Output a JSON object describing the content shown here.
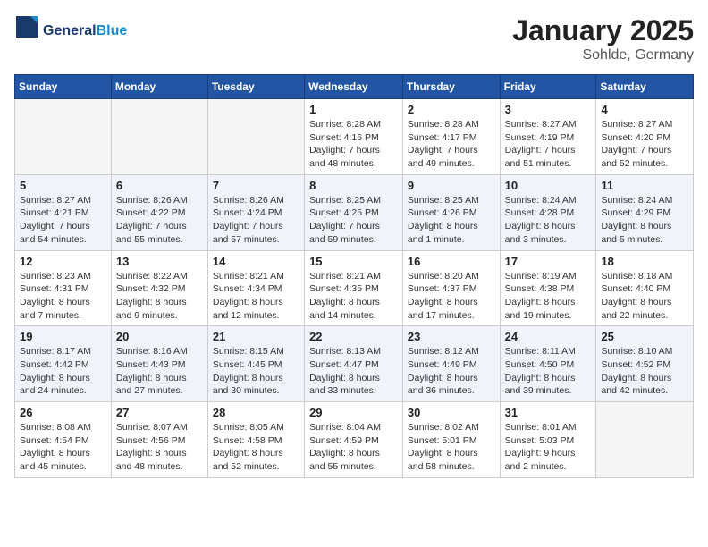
{
  "header": {
    "logo_general": "General",
    "logo_blue": "Blue",
    "title": "January 2025",
    "subtitle": "Sohlde, Germany"
  },
  "weekdays": [
    "Sunday",
    "Monday",
    "Tuesday",
    "Wednesday",
    "Thursday",
    "Friday",
    "Saturday"
  ],
  "weeks": [
    [
      {
        "day": "",
        "info": ""
      },
      {
        "day": "",
        "info": ""
      },
      {
        "day": "",
        "info": ""
      },
      {
        "day": "1",
        "info": "Sunrise: 8:28 AM\nSunset: 4:16 PM\nDaylight: 7 hours and 48 minutes."
      },
      {
        "day": "2",
        "info": "Sunrise: 8:28 AM\nSunset: 4:17 PM\nDaylight: 7 hours and 49 minutes."
      },
      {
        "day": "3",
        "info": "Sunrise: 8:27 AM\nSunset: 4:19 PM\nDaylight: 7 hours and 51 minutes."
      },
      {
        "day": "4",
        "info": "Sunrise: 8:27 AM\nSunset: 4:20 PM\nDaylight: 7 hours and 52 minutes."
      }
    ],
    [
      {
        "day": "5",
        "info": "Sunrise: 8:27 AM\nSunset: 4:21 PM\nDaylight: 7 hours and 54 minutes."
      },
      {
        "day": "6",
        "info": "Sunrise: 8:26 AM\nSunset: 4:22 PM\nDaylight: 7 hours and 55 minutes."
      },
      {
        "day": "7",
        "info": "Sunrise: 8:26 AM\nSunset: 4:24 PM\nDaylight: 7 hours and 57 minutes."
      },
      {
        "day": "8",
        "info": "Sunrise: 8:25 AM\nSunset: 4:25 PM\nDaylight: 7 hours and 59 minutes."
      },
      {
        "day": "9",
        "info": "Sunrise: 8:25 AM\nSunset: 4:26 PM\nDaylight: 8 hours and 1 minute."
      },
      {
        "day": "10",
        "info": "Sunrise: 8:24 AM\nSunset: 4:28 PM\nDaylight: 8 hours and 3 minutes."
      },
      {
        "day": "11",
        "info": "Sunrise: 8:24 AM\nSunset: 4:29 PM\nDaylight: 8 hours and 5 minutes."
      }
    ],
    [
      {
        "day": "12",
        "info": "Sunrise: 8:23 AM\nSunset: 4:31 PM\nDaylight: 8 hours and 7 minutes."
      },
      {
        "day": "13",
        "info": "Sunrise: 8:22 AM\nSunset: 4:32 PM\nDaylight: 8 hours and 9 minutes."
      },
      {
        "day": "14",
        "info": "Sunrise: 8:21 AM\nSunset: 4:34 PM\nDaylight: 8 hours and 12 minutes."
      },
      {
        "day": "15",
        "info": "Sunrise: 8:21 AM\nSunset: 4:35 PM\nDaylight: 8 hours and 14 minutes."
      },
      {
        "day": "16",
        "info": "Sunrise: 8:20 AM\nSunset: 4:37 PM\nDaylight: 8 hours and 17 minutes."
      },
      {
        "day": "17",
        "info": "Sunrise: 8:19 AM\nSunset: 4:38 PM\nDaylight: 8 hours and 19 minutes."
      },
      {
        "day": "18",
        "info": "Sunrise: 8:18 AM\nSunset: 4:40 PM\nDaylight: 8 hours and 22 minutes."
      }
    ],
    [
      {
        "day": "19",
        "info": "Sunrise: 8:17 AM\nSunset: 4:42 PM\nDaylight: 8 hours and 24 minutes."
      },
      {
        "day": "20",
        "info": "Sunrise: 8:16 AM\nSunset: 4:43 PM\nDaylight: 8 hours and 27 minutes."
      },
      {
        "day": "21",
        "info": "Sunrise: 8:15 AM\nSunset: 4:45 PM\nDaylight: 8 hours and 30 minutes."
      },
      {
        "day": "22",
        "info": "Sunrise: 8:13 AM\nSunset: 4:47 PM\nDaylight: 8 hours and 33 minutes."
      },
      {
        "day": "23",
        "info": "Sunrise: 8:12 AM\nSunset: 4:49 PM\nDaylight: 8 hours and 36 minutes."
      },
      {
        "day": "24",
        "info": "Sunrise: 8:11 AM\nSunset: 4:50 PM\nDaylight: 8 hours and 39 minutes."
      },
      {
        "day": "25",
        "info": "Sunrise: 8:10 AM\nSunset: 4:52 PM\nDaylight: 8 hours and 42 minutes."
      }
    ],
    [
      {
        "day": "26",
        "info": "Sunrise: 8:08 AM\nSunset: 4:54 PM\nDaylight: 8 hours and 45 minutes."
      },
      {
        "day": "27",
        "info": "Sunrise: 8:07 AM\nSunset: 4:56 PM\nDaylight: 8 hours and 48 minutes."
      },
      {
        "day": "28",
        "info": "Sunrise: 8:05 AM\nSunset: 4:58 PM\nDaylight: 8 hours and 52 minutes."
      },
      {
        "day": "29",
        "info": "Sunrise: 8:04 AM\nSunset: 4:59 PM\nDaylight: 8 hours and 55 minutes."
      },
      {
        "day": "30",
        "info": "Sunrise: 8:02 AM\nSunset: 5:01 PM\nDaylight: 8 hours and 58 minutes."
      },
      {
        "day": "31",
        "info": "Sunrise: 8:01 AM\nSunset: 5:03 PM\nDaylight: 9 hours and 2 minutes."
      },
      {
        "day": "",
        "info": ""
      }
    ]
  ]
}
